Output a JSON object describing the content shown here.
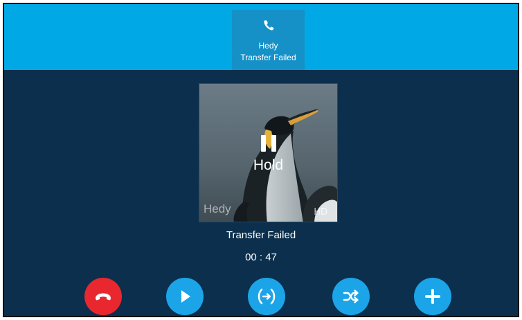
{
  "call_tab": {
    "caller_name": "Hedy",
    "status": "Transfer Failed",
    "icon": "phone-icon"
  },
  "photo": {
    "hold_label": "Hold",
    "caller_watermark": "Hedy",
    "hd_label": "HD",
    "pause_icon": "pause-icon"
  },
  "call_status": "Transfer Failed",
  "call_timer": "00 : 47",
  "colors": {
    "top_bar": "#00a9e6",
    "active_tab": "#1591c7",
    "background": "#0b2f4c",
    "end_call": "#e8282e",
    "action_button": "#1ca4e8"
  },
  "actions": [
    {
      "name": "end-call",
      "icon": "hang-up-icon"
    },
    {
      "name": "resume",
      "icon": "play-icon"
    },
    {
      "name": "transfer",
      "icon": "transfer-icon"
    },
    {
      "name": "swap",
      "icon": "shuffle-icon"
    },
    {
      "name": "new-call",
      "icon": "plus-icon"
    }
  ]
}
